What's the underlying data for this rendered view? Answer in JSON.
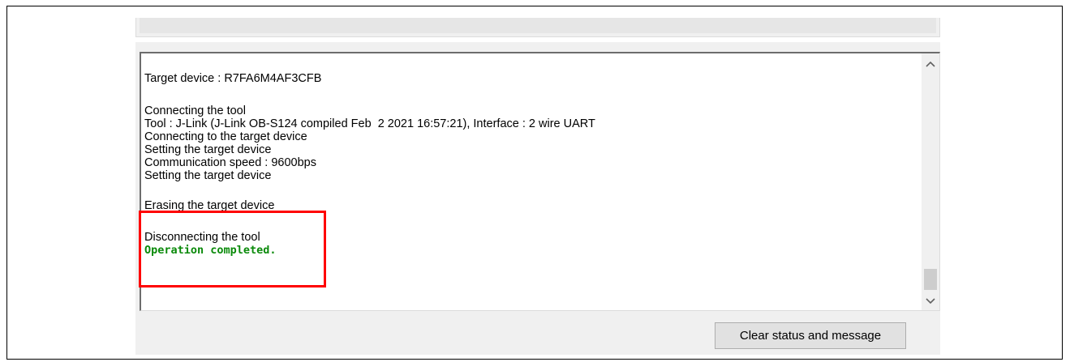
{
  "log": {
    "lines": [
      "Target device : R7FA6M4AF3CFB",
      "Connecting the tool",
      "Tool : J-Link (J-Link OB-S124 compiled Feb  2 2021 16:57:21), Interface : 2 wire UART",
      "Connecting to the target device",
      "Setting the target device",
      "Communication speed : 9600bps",
      "Setting the target device",
      "Erasing the target device",
      "Disconnecting the tool",
      "Operation completed."
    ]
  },
  "scrollbar": {
    "up_icon": "chevron-up-icon",
    "down_icon": "chevron-down-icon"
  },
  "buttons": {
    "clear_label": "Clear status and message"
  },
  "colors": {
    "success_text": "#0a8a0a",
    "highlight_border": "#ff0000"
  }
}
